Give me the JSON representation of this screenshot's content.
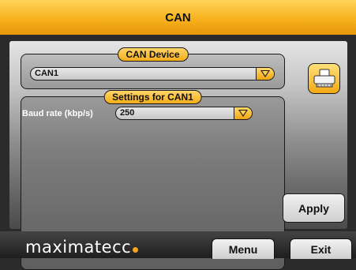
{
  "title": "CAN",
  "can_device": {
    "legend": "CAN Device",
    "selected": "CAN1"
  },
  "settings": {
    "legend": "Settings for CAN1",
    "baud_label": "Baud rate (kbp/s)",
    "baud_value": "250"
  },
  "icons": {
    "side_icon": "can-connector-icon",
    "dropdown": "chevron-down-icon"
  },
  "apply_label": "Apply",
  "footer": {
    "logo": "maximatecc",
    "menu_label": "Menu",
    "exit_label": "Exit"
  },
  "colors": {
    "accent": "#f7b21c",
    "panel": "#8c8c8c",
    "bar": "#2b2b2b"
  }
}
